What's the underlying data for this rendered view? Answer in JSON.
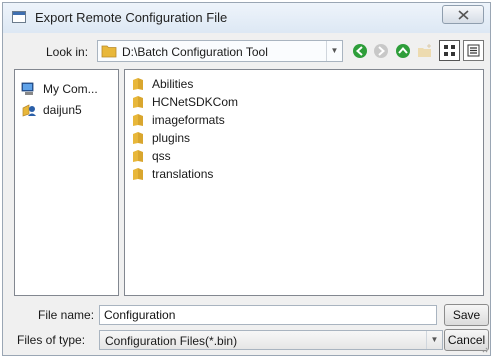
{
  "window": {
    "title": "Export Remote Configuration File",
    "close_icon": "close-icon"
  },
  "toolbar": {
    "look_in_label": "Look in:",
    "path": "D:\\Batch Configuration Tool",
    "icons": [
      "back-icon",
      "forward-icon",
      "up-folder-icon",
      "new-folder-icon",
      "detail-view-icon",
      "list-view-icon"
    ]
  },
  "places": {
    "items": [
      {
        "label": "My Com...",
        "icon": "computer-icon"
      },
      {
        "label": "daijun5",
        "icon": "user-icon"
      }
    ]
  },
  "files": {
    "items": [
      {
        "label": "Abilities",
        "icon": "folder-icon"
      },
      {
        "label": "HCNetSDKCom",
        "icon": "folder-icon"
      },
      {
        "label": "imageformats",
        "icon": "folder-icon"
      },
      {
        "label": "plugins",
        "icon": "folder-icon"
      },
      {
        "label": "qss",
        "icon": "folder-icon"
      },
      {
        "label": "translations",
        "icon": "folder-icon"
      }
    ]
  },
  "footer": {
    "file_name_label": "File name:",
    "file_name_value": "Configuration",
    "file_type_label": "Files of type:",
    "file_type_value": "Configuration Files(*.bin)",
    "save_label": "Save",
    "cancel_label": "Cancel"
  },
  "colors": {
    "folder": "#e8b73a",
    "nav_green": "#2e9e3a",
    "dialog_bg": "#f0f0f0"
  }
}
